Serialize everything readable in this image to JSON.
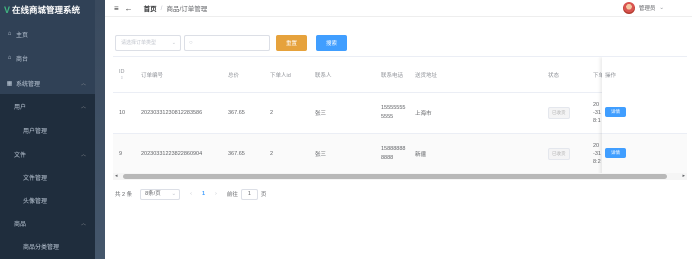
{
  "app": {
    "title": "在线商城管理系统",
    "logo_glyph": "V"
  },
  "sidebar": {
    "items": [
      {
        "label": "主页",
        "icon": "home-icon"
      },
      {
        "label": "商台",
        "icon": "shop-icon"
      },
      {
        "label": "系统管理",
        "icon": "grid-icon"
      },
      {
        "label": "用户"
      },
      {
        "label": "用户管理"
      },
      {
        "label": "文件"
      },
      {
        "label": "文件管理"
      },
      {
        "label": "头像管理"
      },
      {
        "label": "商品"
      },
      {
        "label": "商品分类管理"
      }
    ]
  },
  "header": {
    "breadcrumb_home": "首页",
    "breadcrumb_sep": "/",
    "breadcrumb_current": "商品/订单管理",
    "user_name": "管理员"
  },
  "toolbar": {
    "select_placeholder": "请选择订单类型",
    "search_placeholder": "",
    "reset_label": "重置",
    "search_label": "搜索"
  },
  "table": {
    "columns": [
      {
        "id": "id",
        "label": "ID",
        "sort_glyph": "⇕"
      },
      {
        "id": "order_no",
        "label": "订单编号"
      },
      {
        "id": "total",
        "label": "总价"
      },
      {
        "id": "uid",
        "label": "下单人id"
      },
      {
        "id": "contact",
        "label": "联系人"
      },
      {
        "id": "phone",
        "label": "联系电话"
      },
      {
        "id": "address",
        "label": "送货地址"
      },
      {
        "id": "status",
        "label": "状态"
      },
      {
        "id": "time",
        "label": "下单"
      },
      {
        "id": "op",
        "label": "操作"
      }
    ],
    "rows": [
      {
        "id": "10",
        "order_no": "20230331230812283586",
        "total": "367.65",
        "uid": "2",
        "contact": "张三",
        "phone_1": "15555555",
        "phone_2": "5555",
        "address": "上海市",
        "status": "已收货",
        "time_1": "20",
        "time_2": "-31",
        "time_3": "8:1",
        "op": "详情"
      },
      {
        "id": "9",
        "order_no": "20230331223822860904",
        "total": "367.65",
        "uid": "2",
        "contact": "张三",
        "phone_1": "15888888",
        "phone_2": "8888",
        "address": "新疆",
        "status": "已收货",
        "time_1": "20",
        "time_2": "-31",
        "time_3": "8:2",
        "op": "详情"
      }
    ]
  },
  "pagination": {
    "total_text": "共 2 条",
    "page_size": "8条/页",
    "current_page": "1",
    "goto_label": "前往",
    "goto_value": "1",
    "page_suffix": "页"
  },
  "colors": {
    "sidebar_bg": "#304156",
    "primary": "#409eff",
    "warning": "#e6a23c"
  }
}
